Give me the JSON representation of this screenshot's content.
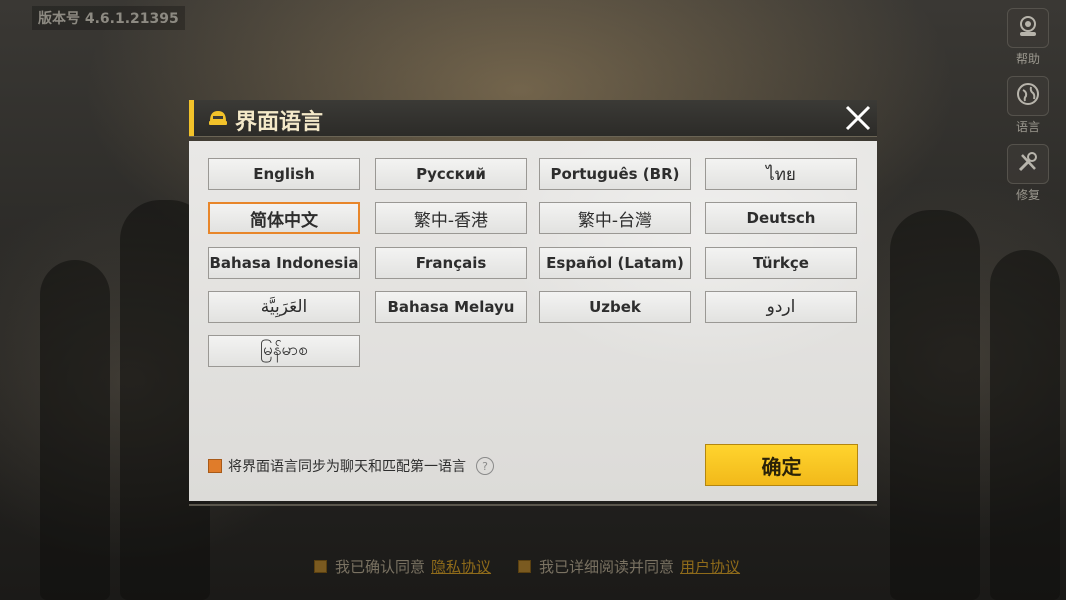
{
  "version": "版本号 4.6.1.21395",
  "sidebar": {
    "items": [
      {
        "label": "帮助",
        "icon": "help-agent-icon"
      },
      {
        "label": "语言",
        "icon": "globe-icon"
      },
      {
        "label": "修复",
        "icon": "tools-icon"
      }
    ]
  },
  "dialog": {
    "title": "界面语言",
    "title_icon": "helmet-icon",
    "close_icon": "close-icon",
    "languages": [
      "English",
      "Русский",
      "Português (BR)",
      "ไทย",
      "简体中文",
      "繁中-香港",
      "繁中-台灣",
      "Deutsch",
      "Bahasa Indonesia",
      "Français",
      "Español (Latam)",
      "Türkçe",
      "العَرَبِيَّة",
      "Bahasa Melayu",
      "Uzbek",
      "اردو",
      "မြန်မာစ"
    ],
    "selected_language": "简体中文",
    "sync_checkbox": {
      "checked": true,
      "label": "将界面语言同步为聊天和匹配第一语言"
    },
    "help_icon": "question-circle-icon",
    "help_glyph": "?",
    "confirm_label": "确定"
  },
  "footer": {
    "privacy_text": "我已确认同意",
    "privacy_link": "隐私协议",
    "agreement_text": "我已详细阅读并同意",
    "agreement_link": "用户协议"
  },
  "colors": {
    "accent_yellow": "#f2c22a",
    "selected_border": "#e8862a",
    "confirm_button": "#ffd42e"
  }
}
